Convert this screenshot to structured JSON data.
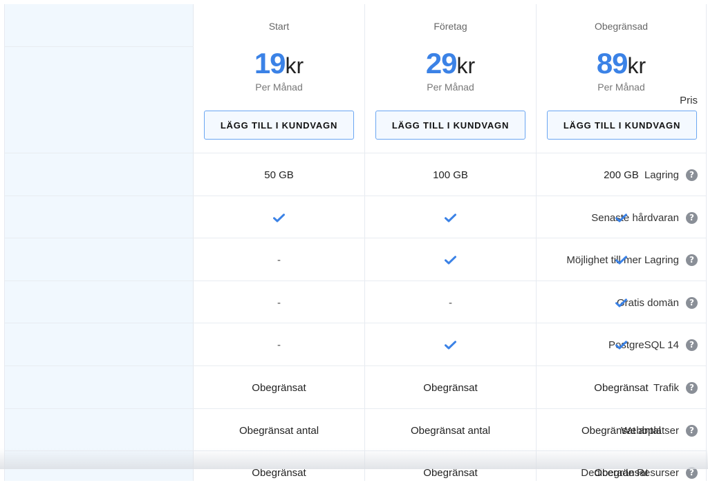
{
  "labels": {
    "pris": "Pris",
    "features": [
      "Lagring",
      "Senaste hårdvaran",
      "Möjlighet till mer Lagring",
      "Gratis domän",
      "PostgreSQL 14",
      "Trafik",
      "Webbplatser",
      "Dedicerade Resurser"
    ]
  },
  "help_glyph": "?",
  "plans": [
    {
      "name": "Start",
      "price": "19",
      "currency": "kr",
      "period": "Per Månad",
      "button": "LÄGG TILL I KUNDVAGN",
      "values": [
        "50 GB",
        "check",
        "-",
        "-",
        "-",
        "Obegränsat",
        "Obegränsat antal",
        "Obegränsat"
      ]
    },
    {
      "name": "Företag",
      "price": "29",
      "currency": "kr",
      "period": "Per Månad",
      "button": "LÄGG TILL I KUNDVAGN",
      "values": [
        "100 GB",
        "check",
        "check",
        "-",
        "check",
        "Obegränsat",
        "Obegränsat antal",
        "Obegränsat"
      ]
    },
    {
      "name": "Obegränsad",
      "price": "89",
      "currency": "kr",
      "period": "Per Månad",
      "button": "LÄGG TILL I KUNDVAGN",
      "values": [
        "200 GB",
        "check",
        "check",
        "check",
        "check",
        "Obegränsat",
        "Obegränsat antal",
        "Obegränsat"
      ]
    }
  ],
  "colors": {
    "accent": "#3b82e6",
    "label_bg": "#f1f8fe",
    "check": "#3b82e6"
  },
  "icons": {
    "help": "question-circle-icon",
    "check": "checkmark-icon"
  }
}
